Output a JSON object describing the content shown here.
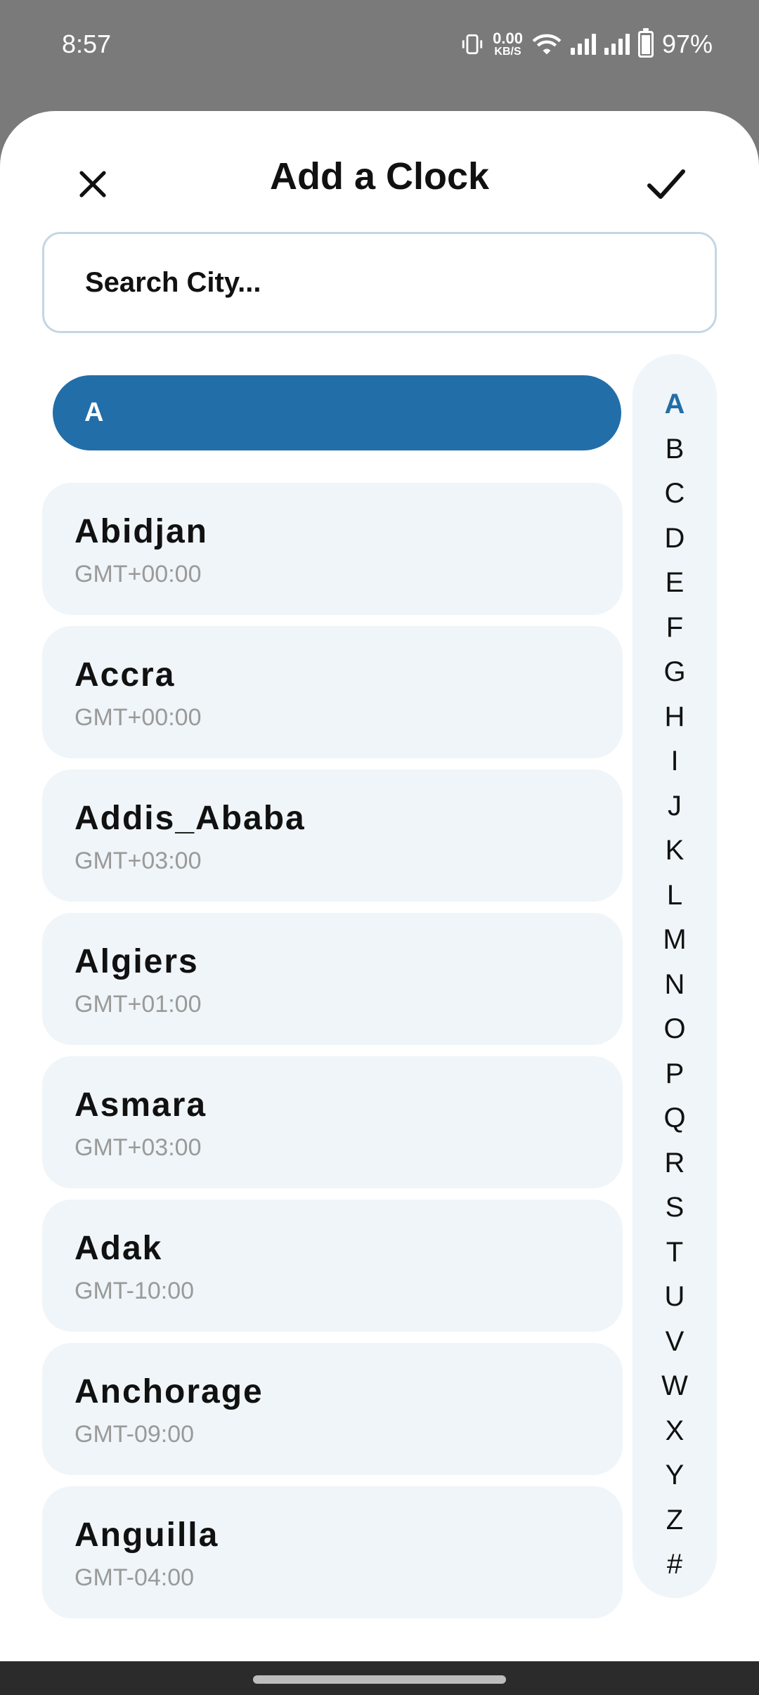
{
  "status_bar": {
    "time": "8:57",
    "net_speed_value": "0.00",
    "net_speed_unit": "KB/S",
    "battery": "97%"
  },
  "header": {
    "title": "Add a Clock",
    "close_icon": "close-icon",
    "confirm_icon": "check-icon"
  },
  "search": {
    "placeholder": "Search City..."
  },
  "list": {
    "section": "A",
    "items": [
      {
        "name": "Abidjan",
        "tz": "GMT+00:00"
      },
      {
        "name": "Accra",
        "tz": "GMT+00:00"
      },
      {
        "name": "Addis_Ababa",
        "tz": "GMT+03:00"
      },
      {
        "name": "Algiers",
        "tz": "GMT+01:00"
      },
      {
        "name": "Asmara",
        "tz": "GMT+03:00"
      },
      {
        "name": "Adak",
        "tz": "GMT-10:00"
      },
      {
        "name": "Anchorage",
        "tz": "GMT-09:00"
      },
      {
        "name": "Anguilla",
        "tz": "GMT-04:00"
      }
    ]
  },
  "index": {
    "active": "A",
    "letters": [
      "A",
      "B",
      "C",
      "D",
      "E",
      "F",
      "G",
      "H",
      "I",
      "J",
      "K",
      "L",
      "M",
      "N",
      "O",
      "P",
      "Q",
      "R",
      "S",
      "T",
      "U",
      "V",
      "W",
      "X",
      "Y",
      "Z",
      "#"
    ]
  },
  "colors": {
    "accent": "#226ea8",
    "item_bg": "#eff5f8",
    "scrim": "#7a7a7a"
  }
}
